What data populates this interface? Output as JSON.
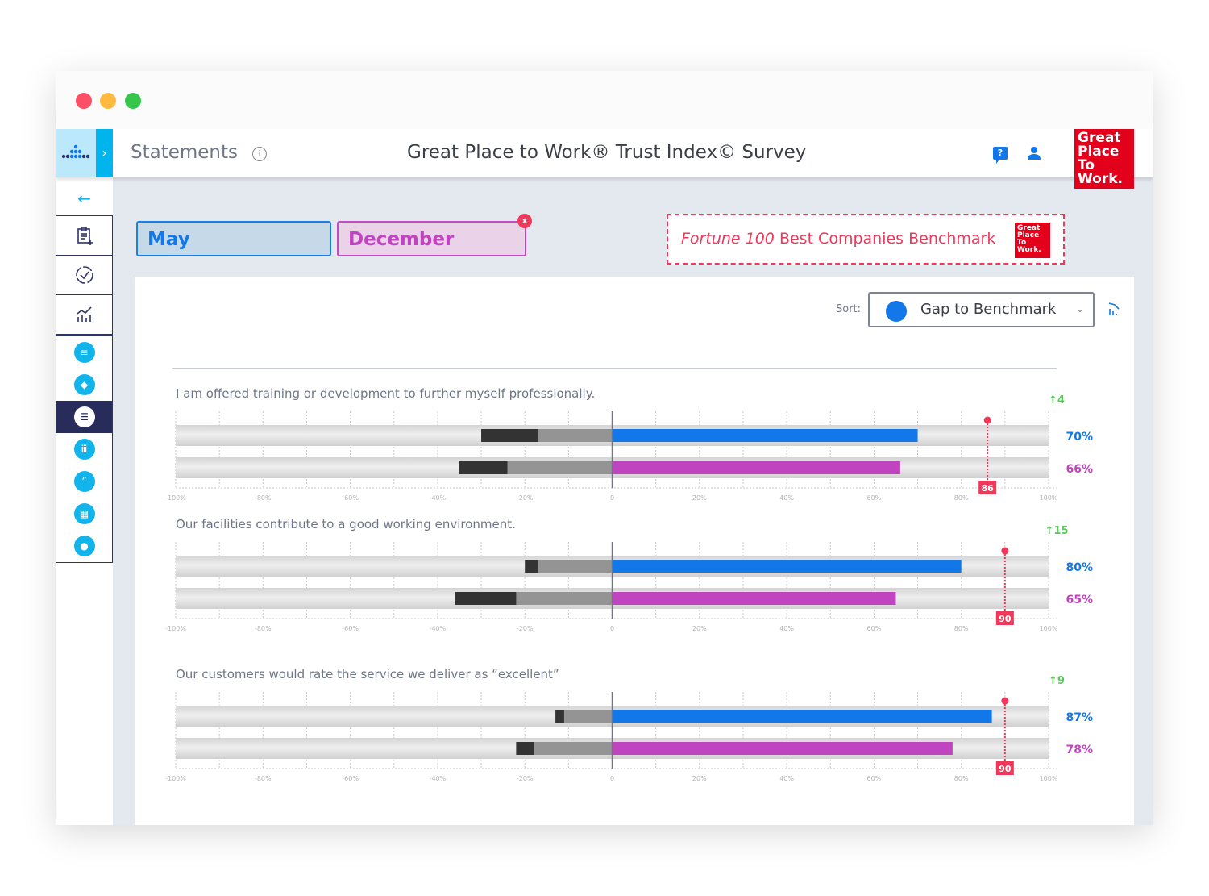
{
  "window": {
    "controls": [
      "close",
      "minimize",
      "maximize"
    ]
  },
  "header": {
    "page_title": "Statements",
    "survey_title": "Great Place to Work® Trust Index© Survey",
    "logo_lines": [
      "Great",
      "Place",
      "To",
      "Work."
    ],
    "help_icon": "help-chat-icon",
    "user_icon": "user-icon"
  },
  "sidebar": {
    "back_icon": "arrow-left-icon",
    "items": [
      {
        "name": "survey-add",
        "icon": "clipboard-plus-icon",
        "active": false
      },
      {
        "name": "progress",
        "icon": "circle-check-icon",
        "active": false
      },
      {
        "name": "analytics",
        "icon": "chart-trend-icon",
        "active": false
      },
      {
        "name": "report",
        "icon": "document-icon",
        "active": false
      },
      {
        "name": "layers",
        "icon": "layers-icon",
        "active": false
      },
      {
        "name": "statements",
        "icon": "checklist-icon",
        "active": true
      },
      {
        "name": "demographics",
        "icon": "people-icon",
        "active": false
      },
      {
        "name": "comments",
        "icon": "quote-icon",
        "active": false
      },
      {
        "name": "heatmap",
        "icon": "grid-chart-icon",
        "active": false
      },
      {
        "name": "admin",
        "icon": "user-key-icon",
        "active": false
      }
    ]
  },
  "periods": {
    "primary": "May",
    "secondary": "December",
    "remove_label": "x"
  },
  "benchmark": {
    "italic_part": "Fortune 100",
    "rest": " Best Companies Benchmark",
    "logo_lines": [
      "Great",
      "Place",
      "To",
      "Work."
    ]
  },
  "sort": {
    "label": "Sort:",
    "value": "Gap to Benchmark"
  },
  "colors": {
    "primary": "#1277e8",
    "secondary": "#c043c0",
    "benchmark": "#f0385a",
    "gain": "#5ac85a",
    "neg_dark": "#333333",
    "neg_light": "#949494"
  },
  "chart_data": {
    "type": "bar",
    "x_ticks": [
      "-100%",
      "-80%",
      "-60%",
      "-40%",
      "-20%",
      "0",
      "20%",
      "40%",
      "60%",
      "80%",
      "100%"
    ],
    "xlim": [
      -100,
      100
    ],
    "series_names": [
      "May",
      "December"
    ],
    "statements": [
      {
        "text": "I am offered training or development to further myself professionally.",
        "change": "4",
        "benchmark": 86,
        "rows": [
          {
            "series": "May",
            "positive": 70,
            "label": "70%",
            "neg_light": 17,
            "neg_dark": 30
          },
          {
            "series": "December",
            "positive": 66,
            "label": "66%",
            "neg_light": 24,
            "neg_dark": 35
          }
        ]
      },
      {
        "text": "Our facilities contribute to a good working environment.",
        "change": "15",
        "benchmark": 90,
        "rows": [
          {
            "series": "May",
            "positive": 80,
            "label": "80%",
            "neg_light": 17,
            "neg_dark": 20
          },
          {
            "series": "December",
            "positive": 65,
            "label": "65%",
            "neg_light": 22,
            "neg_dark": 36
          }
        ]
      },
      {
        "text": "Our customers would rate the service we deliver as “excellent”",
        "change": "9",
        "benchmark": 90,
        "rows": [
          {
            "series": "May",
            "positive": 87,
            "label": "87%",
            "neg_light": 11,
            "neg_dark": 13
          },
          {
            "series": "December",
            "positive": 78,
            "label": "78%",
            "neg_light": 18,
            "neg_dark": 22
          }
        ]
      }
    ]
  }
}
